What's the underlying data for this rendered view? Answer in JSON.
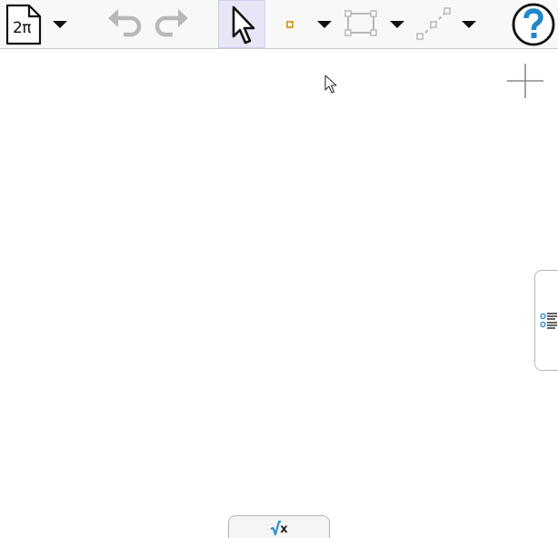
{
  "toolbar": {
    "file_label": "2π",
    "icons": {
      "file": "file-icon",
      "undo": "undo-icon",
      "redo": "redo-icon",
      "move": "arrow-pointer-icon",
      "point": "point-icon",
      "rectangle": "rectangle-icon",
      "segment": "segment-icon",
      "help": "help-icon",
      "dropdown": "caret-down-icon"
    },
    "move_tool_selected": true,
    "undo_enabled": false,
    "redo_enabled": false
  },
  "canvas": {
    "zoom_icon": "plus-icon",
    "algebra_panel_icon": "algebra-list-icon"
  },
  "keyboard_tab": {
    "icon": "sqrt-icon",
    "symbol": "x"
  },
  "colors": {
    "toolbar_bg": "#f8f8f8",
    "selected_tool_bg": "#e6e6f7",
    "point_color": "#d38b00",
    "help_blue": "#1e88c8",
    "disabled_gray": "#b8b8b8",
    "accent_blue": "#2a8fd6"
  }
}
